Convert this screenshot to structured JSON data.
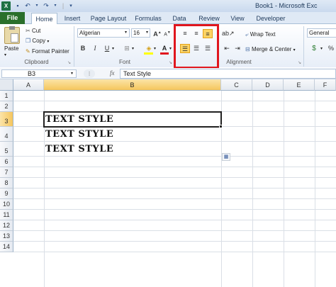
{
  "window": {
    "title": "Book1 - Microsoft Exc"
  },
  "quick_access": {
    "icons": [
      "excel-logo-icon",
      "save-icon",
      "undo-icon",
      "redo-icon",
      "customize-icon"
    ]
  },
  "tabs": [
    "File",
    "Home",
    "Insert",
    "Page Layout",
    "Formulas",
    "Data",
    "Review",
    "View",
    "Developer"
  ],
  "active_tab": "Home",
  "ribbon": {
    "clipboard": {
      "paste": "Paste",
      "cut": "Cut",
      "copy": "Copy",
      "format_painter": "Format Painter",
      "label": "Clipboard"
    },
    "font": {
      "name": "Algerian",
      "size": "16",
      "bold": "B",
      "italic": "I",
      "underline": "U",
      "label": "Font"
    },
    "alignment": {
      "wrap_text": "Wrap Text",
      "merge": "Merge & Center",
      "label": "Alignment"
    },
    "number": {
      "format": "General"
    }
  },
  "formula_bar": {
    "name_box": "B3",
    "fx": "fx",
    "content": "Text Style"
  },
  "sheet": {
    "columns": [
      "A",
      "B",
      "C",
      "D",
      "E",
      "F"
    ],
    "rows": [
      "1",
      "2",
      "3",
      "4",
      "5",
      "6",
      "7",
      "8",
      "9",
      "10",
      "11",
      "12",
      "13",
      "14"
    ],
    "selected_cell": "B3",
    "cells": {
      "b3": "TEXT STYLE",
      "b4": "TEXT STYLE",
      "b5": "TEXT STYLE"
    }
  },
  "colors": {
    "file_tab": "#2a6f2b",
    "highlight": "#fcd464",
    "red_outline": "#e0161e",
    "selection_header": "#f5c65d"
  }
}
